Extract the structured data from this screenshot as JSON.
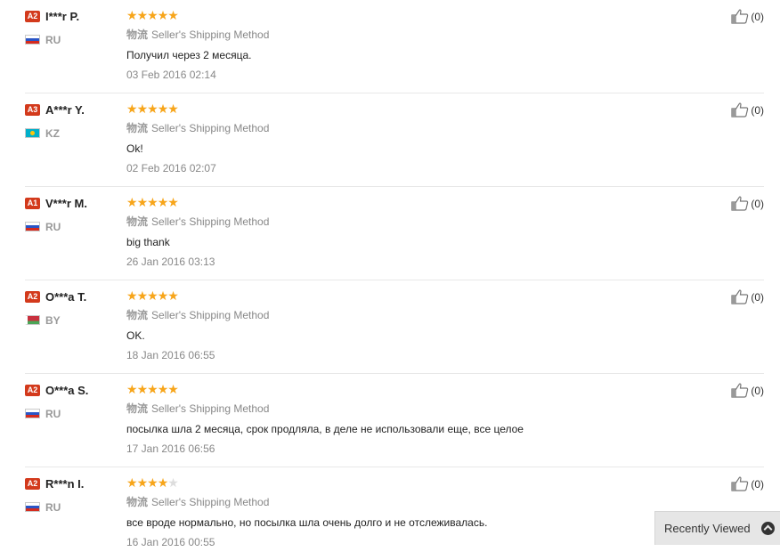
{
  "shipping_label_cn": "物流",
  "reviews": [
    {
      "level": "A2",
      "name": "I***r P.",
      "country": "RU",
      "stars": 5,
      "shipping": "Seller's Shipping Method",
      "comment": "Получил через 2 месяца.",
      "date": "03 Feb 2016 02:14",
      "helpful": "(0)"
    },
    {
      "level": "A3",
      "name": "A***r Y.",
      "country": "KZ",
      "stars": 5,
      "shipping": "Seller's Shipping Method",
      "comment": "Ok!",
      "date": "02 Feb 2016 02:07",
      "helpful": "(0)"
    },
    {
      "level": "A1",
      "name": "V***r M.",
      "country": "RU",
      "stars": 5,
      "shipping": "Seller's Shipping Method",
      "comment": "big thank",
      "date": "26 Jan 2016 03:13",
      "helpful": "(0)"
    },
    {
      "level": "A2",
      "name": "O***a T.",
      "country": "BY",
      "stars": 5,
      "shipping": "Seller's Shipping Method",
      "comment": "OK.",
      "date": "18 Jan 2016 06:55",
      "helpful": "(0)"
    },
    {
      "level": "A2",
      "name": "O***a S.",
      "country": "RU",
      "stars": 5,
      "shipping": "Seller's Shipping Method",
      "comment": "посылка шла 2 месяца, срок продляла, в деле не использовали еще, все целое",
      "date": "17 Jan 2016 06:56",
      "helpful": "(0)"
    },
    {
      "level": "A2",
      "name": "R***n I.",
      "country": "RU",
      "stars": 4,
      "shipping": "Seller's Shipping Method",
      "comment": "все вроде нормально, но посылка шла очень долго и не отслеживалась.",
      "date": "16 Jan 2016 00:55",
      "helpful": "(0)"
    }
  ],
  "recently_viewed": {
    "label": "Recently Viewed",
    "icon": "chevron-up-icon"
  },
  "colors": {
    "star": "#f7a51a",
    "star_empty": "#dddddd",
    "badge": "#d33a1c"
  }
}
